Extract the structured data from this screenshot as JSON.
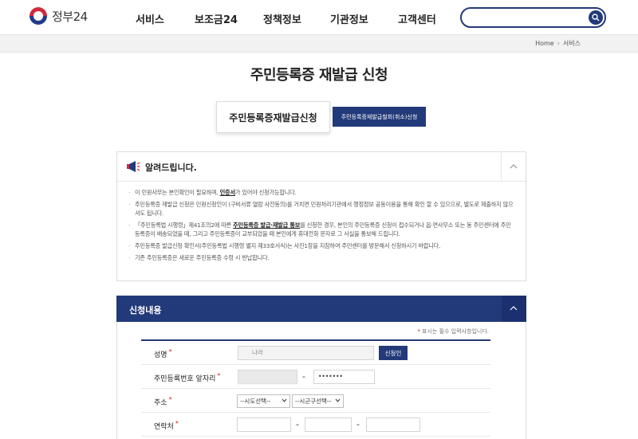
{
  "header": {
    "logo_text": "정부24",
    "nav": [
      "서비스",
      "보조금24",
      "정책정보",
      "기관정보",
      "고객센터"
    ],
    "search_placeholder": ""
  },
  "breadcrumb": [
    "Home",
    "서비스"
  ],
  "page_title": "주민등록증 재발급 신청",
  "tabs": {
    "active": "주민등록증재발급신청",
    "other": "주민등록증재발급철회(취소)신청"
  },
  "notice": {
    "title": "알려드립니다.",
    "items": [
      {
        "pre": "이 민원사무는 본인확인이 필요하며, ",
        "bold": "인증서",
        "post": "가 있어야 신청가능합니다."
      },
      {
        "pre": "주민등록증 재발급 신청은 민원신청인이 (구비서류 열람 사전동의)를 거치면 민원처리기관에서 행정정보 공동이용을 통해 확인 할 수 있으므로, 별도로 제출하지 않으셔도 됩니다.",
        "bold": "",
        "post": ""
      },
      {
        "pre": "「주민등록법 시행령」제41조의2에 따른 ",
        "bold": "주민등록증 발급·재발급 통보",
        "post": "를 신청한 경우, 본인의 주민등록증 신청이 접수되거나 읍·면사무소 또는 동 주민센터에 주민등록증이 배송되었을 때, 그리고 주민등록증이 교부되었을 때 본인에게 휴대전화 문자로 그 사실을 통보해 드립니다."
      },
      {
        "pre": "주민등록증 발급신청 확인서(주민등록법 시행령 별지 제33호서식)는 사진1장을 지참하여 주민센터를 방문해서 신청하시기 바랍니다.",
        "bold": "",
        "post": ""
      },
      {
        "pre": "기존 주민등록증은 새로운 주민등록증 수령 시 반납합니다.",
        "bold": "",
        "post": ""
      }
    ]
  },
  "form": {
    "title": "신청내용",
    "required_note": "표시는 필수 입력사항입니다.",
    "name_label": "성명",
    "name_value": "나라",
    "name_button": "신청인",
    "rrn_label": "주민등록번호 앞자리",
    "rrn_back_value": "•••••••",
    "address_label": "주소",
    "address_sido": "--시도선택--",
    "address_sigungu": "--시군구선택--",
    "contact_label": "연락처"
  },
  "colors": {
    "primary": "#233a7a",
    "required": "#d21c1c"
  }
}
